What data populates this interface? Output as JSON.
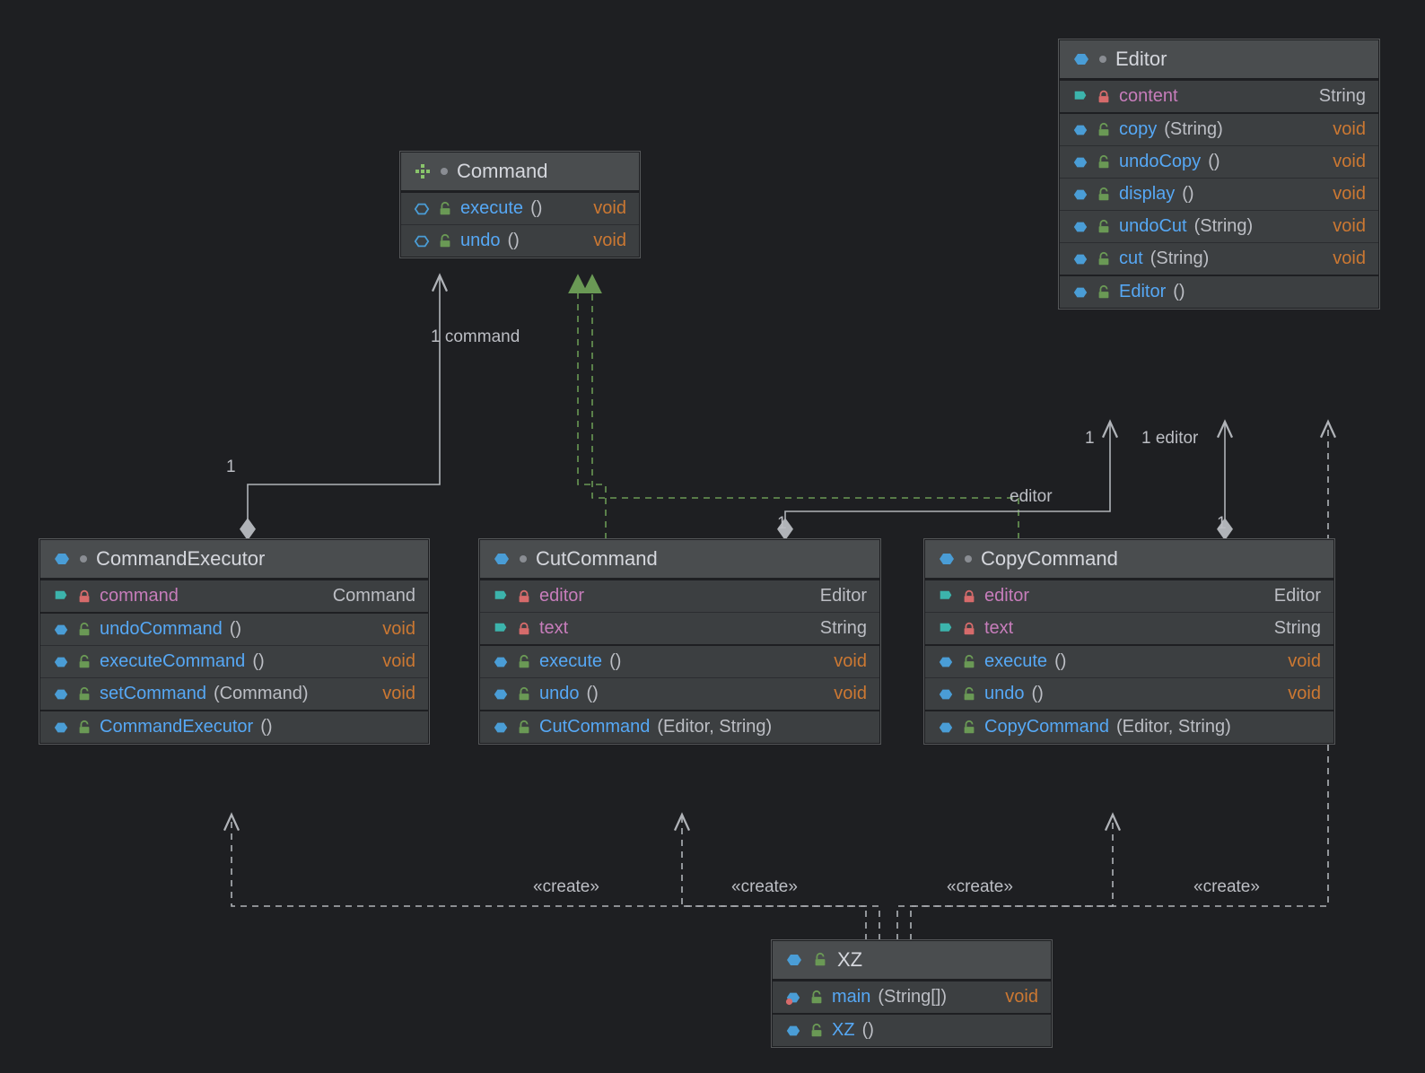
{
  "classes": {
    "command": {
      "name": "Command",
      "methods": [
        {
          "name": "execute",
          "params": "()",
          "ret": "void"
        },
        {
          "name": "undo",
          "params": "()",
          "ret": "void"
        }
      ]
    },
    "editor": {
      "name": "Editor",
      "fields": [
        {
          "name": "content",
          "type": "String"
        }
      ],
      "methods": [
        {
          "name": "copy",
          "params": "(String)",
          "ret": "void"
        },
        {
          "name": "undoCopy",
          "params": "()",
          "ret": "void"
        },
        {
          "name": "display",
          "params": "()",
          "ret": "void"
        },
        {
          "name": "undoCut",
          "params": "(String)",
          "ret": "void"
        },
        {
          "name": "cut",
          "params": "(String)",
          "ret": "void"
        }
      ],
      "ctors": [
        {
          "name": "Editor",
          "params": "()"
        }
      ]
    },
    "executor": {
      "name": "CommandExecutor",
      "fields": [
        {
          "name": "command",
          "type": "Command"
        }
      ],
      "methods": [
        {
          "name": "undoCommand",
          "params": "()",
          "ret": "void"
        },
        {
          "name": "executeCommand",
          "params": "()",
          "ret": "void"
        },
        {
          "name": "setCommand",
          "params": "(Command)",
          "ret": "void"
        }
      ],
      "ctors": [
        {
          "name": "CommandExecutor",
          "params": "()"
        }
      ]
    },
    "cut": {
      "name": "CutCommand",
      "fields": [
        {
          "name": "editor",
          "type": "Editor"
        },
        {
          "name": "text",
          "type": "String"
        }
      ],
      "methods": [
        {
          "name": "execute",
          "params": "()",
          "ret": "void"
        },
        {
          "name": "undo",
          "params": "()",
          "ret": "void"
        }
      ],
      "ctors": [
        {
          "name": "CutCommand",
          "params": "(Editor, String)"
        }
      ]
    },
    "copy": {
      "name": "CopyCommand",
      "fields": [
        {
          "name": "editor",
          "type": "Editor"
        },
        {
          "name": "text",
          "type": "String"
        }
      ],
      "methods": [
        {
          "name": "execute",
          "params": "()",
          "ret": "void"
        },
        {
          "name": "undo",
          "params": "()",
          "ret": "void"
        }
      ],
      "ctors": [
        {
          "name": "CopyCommand",
          "params": "(Editor, String)"
        }
      ]
    },
    "xz": {
      "name": "XZ",
      "methods": [
        {
          "name": "main",
          "params": "(String[])",
          "ret": "void"
        }
      ],
      "ctors": [
        {
          "name": "XZ",
          "params": "()"
        }
      ]
    }
  },
  "labels": {
    "one": "1",
    "command": "command",
    "editor": "editor",
    "oneEditor": "1 editor",
    "create": "«create»"
  }
}
